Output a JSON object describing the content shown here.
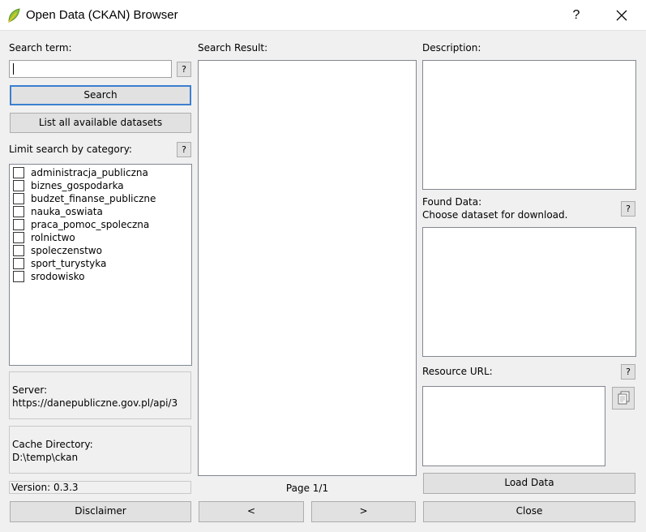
{
  "window": {
    "title": "Open Data (CKAN) Browser",
    "help_glyph": "?"
  },
  "left": {
    "search_term_label": "Search term:",
    "search_value": "",
    "help": "?",
    "search_button": "Search",
    "list_all_button": "List all available datasets",
    "category_label": "Limit search by category:",
    "categories": [
      "administracja_publiczna",
      "biznes_gospodarka",
      "budzet_finanse_publiczne",
      "nauka_oswiata",
      "praca_pomoc_spoleczna",
      "rolnictwo",
      "spoleczenstwo",
      "sport_turystyka",
      "srodowisko"
    ],
    "server_label": "Server:",
    "server_value": "https://danepubliczne.gov.pl/api/3",
    "cache_label": "Cache Directory:",
    "cache_value": "D:\\temp\\ckan",
    "version": "Version: 0.3.3",
    "disclaimer_button": "Disclaimer"
  },
  "middle": {
    "search_result_label": "Search Result:",
    "page_indicator": "Page 1/1",
    "prev_button": "<",
    "next_button": ">"
  },
  "right": {
    "description_label": "Description:",
    "found_data_label": "Found Data:",
    "found_data_hint": "Choose dataset for download.",
    "resource_url_label": "Resource URL:",
    "help": "?",
    "load_data_button": "Load Data",
    "close_button": "Close"
  }
}
